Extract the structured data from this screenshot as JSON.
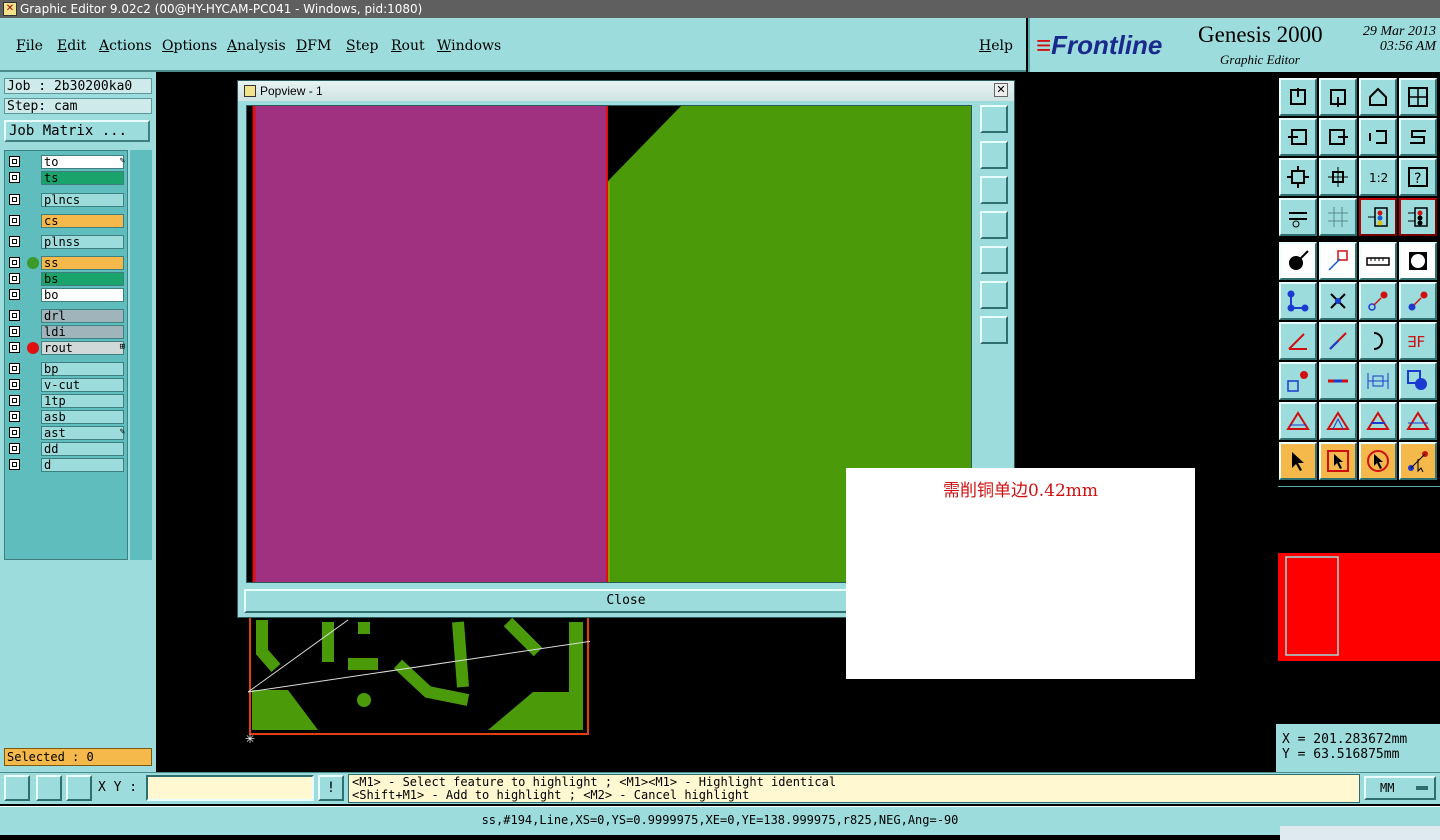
{
  "window": {
    "title": "Graphic Editor 9.02c2 (00@HY-HYCAM-PC041 - Windows, pid:1080)"
  },
  "menu": {
    "items": [
      "File",
      "Edit",
      "Actions",
      "Options",
      "Analysis",
      "DFM",
      "Step",
      "Rout",
      "Windows"
    ],
    "help": "Help"
  },
  "brand": {
    "logo_main": "Frontline",
    "product": "Genesis 2000",
    "subtitle": "Graphic Editor",
    "date": "29 Mar 2013",
    "time": "03:56 AM"
  },
  "job": {
    "job": "Job : 2b30200ka0",
    "step": "Step: cam",
    "matrix_button": "Job Matrix ..."
  },
  "layers": [
    {
      "name": "to",
      "color": "#ffffff",
      "dot": "",
      "mark": "✎"
    },
    {
      "name": "ts",
      "color": "#1aa36a",
      "dot": "",
      "mark": ""
    },
    {
      "name": "plncs",
      "color": "#9cdcdc",
      "dot": "",
      "mark": ""
    },
    {
      "name": "cs",
      "color": "#f5b84a",
      "dot": "",
      "mark": ""
    },
    {
      "name": "plnss",
      "color": "#9cdcdc",
      "dot": "",
      "mark": ""
    },
    {
      "name": "ss",
      "color": "#f5b84a",
      "dot": "#3a9a2a",
      "mark": ""
    },
    {
      "name": "bs",
      "color": "#1aa36a",
      "dot": "",
      "mark": ""
    },
    {
      "name": "bo",
      "color": "#ffffff",
      "dot": "",
      "mark": ""
    },
    {
      "name": "drl",
      "color": "#a0b4bc",
      "dot": "",
      "mark": ""
    },
    {
      "name": "ldi",
      "color": "#a0b4bc",
      "dot": "",
      "mark": ""
    },
    {
      "name": "rout",
      "color": "#d0d8d8",
      "dot": "#e01010",
      "mark": "⊞"
    },
    {
      "name": "bp",
      "color": "#9cdcdc",
      "dot": "",
      "mark": ""
    },
    {
      "name": "v-cut",
      "color": "#9cdcdc",
      "dot": "",
      "mark": ""
    },
    {
      "name": "1tp",
      "color": "#9cdcdc",
      "dot": "",
      "mark": ""
    },
    {
      "name": "asb",
      "color": "#9cdcdc",
      "dot": "",
      "mark": ""
    },
    {
      "name": "ast",
      "color": "#9cdcdc",
      "dot": "",
      "mark": "✎"
    },
    {
      "name": "dd",
      "color": "#9cdcdc",
      "dot": "",
      "mark": ""
    },
    {
      "name": "d",
      "color": "#9cdcdc",
      "dot": "",
      "mark": ""
    }
  ],
  "selected": "Selected : 0",
  "popview": {
    "title": "Popview - 1",
    "close_label": "Close"
  },
  "note": {
    "text": "需削铜单边0.42mm"
  },
  "coords": {
    "x": "X = 201.283672mm",
    "y": "Y =  63.516875mm"
  },
  "bottom": {
    "xy_label": "X Y :",
    "xy_value": "",
    "hint_line1": "<M1> - Select feature to highlight ; <M1><M1> - Highlight identical",
    "hint_line2": "<Shift+M1> - Add to highlight ; <M2> - Cancel highlight",
    "unit": "MM"
  },
  "status": "ss,#194,Line,XS=0,YS=0.9999975,XE=0,YE=138.999975,r825,NEG,Ang=-90",
  "colors": {
    "copper": "#4a9a0a",
    "mask": "#a03080",
    "accent": "#9cdcdc"
  }
}
